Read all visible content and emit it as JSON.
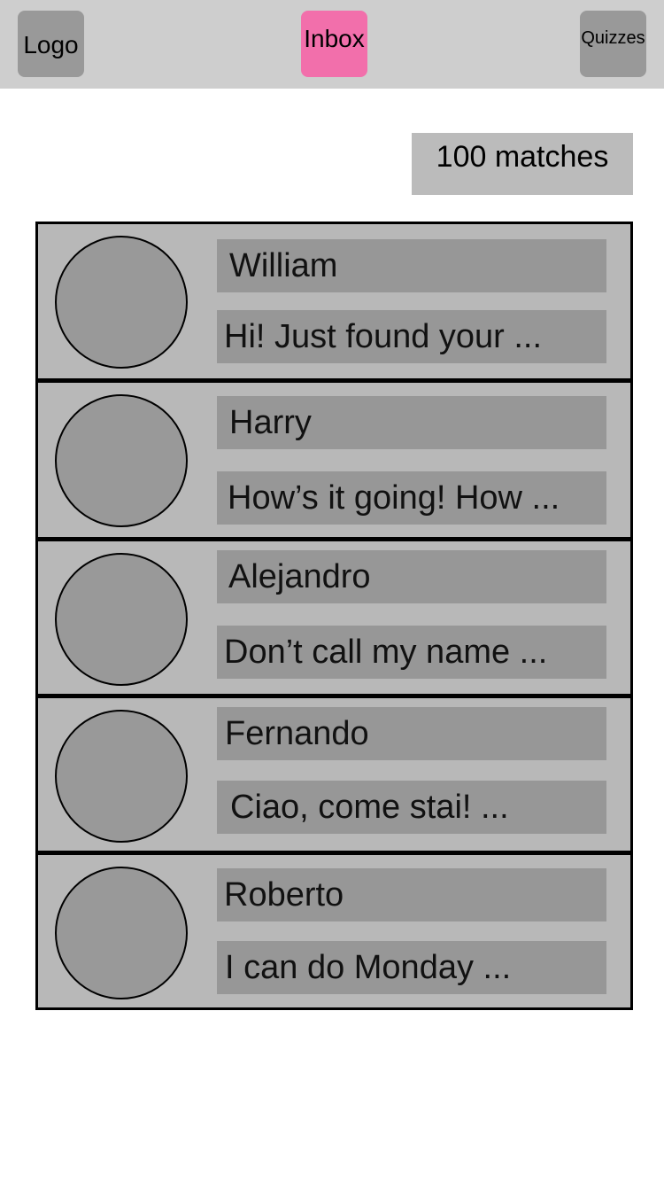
{
  "header": {
    "logo_label": "Logo",
    "inbox_label": "Inbox",
    "quizzes_label": "Quizzes",
    "colors": {
      "bar": "#cecece",
      "button": "#999999",
      "active_button": "#f26fab"
    }
  },
  "matches": {
    "count_label": "100 matches"
  },
  "conversations": [
    {
      "name": "William",
      "preview": "Hi! Just found your ..."
    },
    {
      "name": "Harry",
      "preview": "How’s it going! How ..."
    },
    {
      "name": "Alejandro",
      "preview": "Don’t call my name ..."
    },
    {
      "name": "Fernando",
      "preview": "Ciao, come stai! ..."
    },
    {
      "name": "Roberto",
      "preview": "I can do Monday ..."
    }
  ]
}
